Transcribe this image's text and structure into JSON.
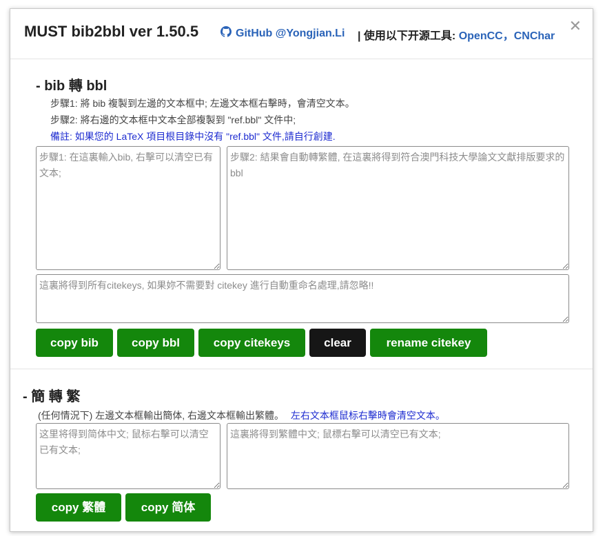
{
  "header": {
    "title": "MUST bib2bbl ver 1.50.5",
    "github_label": "GitHub @Yongjian.Li",
    "tools_prefix": "| 使用以下开源工具: ",
    "tool_1": "OpenCC",
    "tool_sep": "，",
    "tool_2": "CNChar",
    "close_glyph": "✕",
    "github_icon": "github-icon"
  },
  "section_bib": {
    "title": "- bib 轉 bbl",
    "step1": "步驟1: 將 bib 複製到左邊的文本框中; 左邊文本框右擊時，會清空文本。",
    "step2": "步驟2: 將右邊的文本框中文本全部複製到 \"ref.bbl\" 文件中;",
    "note": "備註: 如果您的 LaTeX 項目根目錄中沒有 \"ref.bbl\" 文件,請自行創建.",
    "input_placeholder": "步驟1: 在這裏輸入bib, 右擊可以清空已有文本;",
    "output_placeholder": "步驟2: 結果會自動轉繁體, 在這裏將得到符合澳門科技大學論文文獻排版要求的 bbl",
    "citekeys_placeholder": "這裏將得到所有citekeys, 如果妳不需要對 citekey 進行自動重命名處理,請忽略!!",
    "buttons": {
      "copy_bib": "copy bib",
      "copy_bbl": "copy bbl",
      "copy_citekeys": "copy citekeys",
      "clear": "clear",
      "rename_citekey": "rename citekey"
    }
  },
  "section_conv": {
    "title": "- 簡 轉 繁",
    "desc": "(任何情況下) 左邊文本框輸出簡体, 右邊文本框輸出繁體。",
    "note": "左右文本框鼠标右擊時會清空文本。",
    "simplified_placeholder": "这里将得到简体中文; 鼠标右擊可以清空已有文本;",
    "traditional_placeholder": "這裏將得到繁體中文; 鼠標右擊可以清空已有文本;",
    "buttons": {
      "copy_traditional": "copy 繁體",
      "copy_simplified": "copy 简体"
    }
  },
  "colors": {
    "accent_green": "#14870c",
    "dark_button": "#161616",
    "link_blue": "#2a63b8",
    "note_blue": "#1d2bd0"
  }
}
